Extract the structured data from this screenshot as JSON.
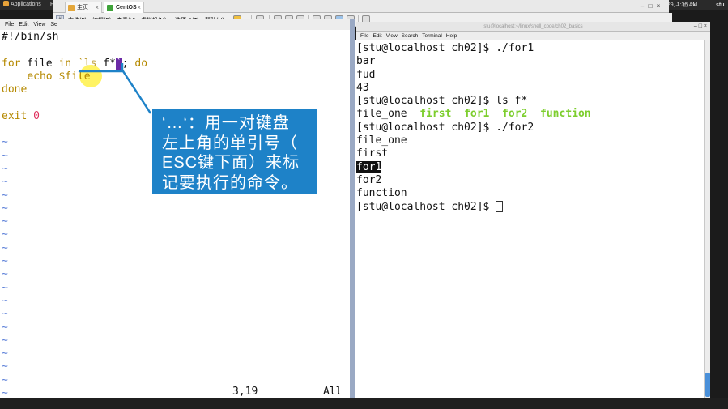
{
  "topbar": {
    "applications": "Applications",
    "places": "Pl",
    "clock": "h 29,  1:36 AM",
    "user": "stu"
  },
  "vmware": {
    "tabs": [
      {
        "label": "主页",
        "icon_color": "#e3a63a"
      },
      {
        "label": "CentOS",
        "icon_color": "#3fa33a"
      }
    ],
    "menu": [
      "文件(F)",
      "编辑(E)",
      "查看(V)",
      "虚拟机(M)",
      "选项卡(T)",
      "帮助(H)"
    ]
  },
  "vim": {
    "menu": [
      "File",
      "Edit",
      "View",
      "Se"
    ],
    "lines": {
      "shebang": "#!/bin/sh",
      "for_kw": "for",
      "file_var": " file ",
      "in_kw": "in",
      "space": " ",
      "backtick": "`",
      "ls_cmd": "ls",
      "glob": " f*",
      "cursor_char": "`",
      "semi": "; ",
      "do_kw": "do",
      "echo_indent": "    ",
      "echo_kw": "echo",
      "echo_var": " $file",
      "done_kw": "done",
      "exit_kw": "exit",
      "exit_code": "0",
      "tilde": "~"
    },
    "status_position": "3,19",
    "status_scope": "All"
  },
  "annotation": {
    "lines": [
      "‘…‘：用一对键盘",
      "左上角的单引号（",
      "ESC键下面）来标",
      "记要执行的命令。"
    ]
  },
  "terminal": {
    "title": "stu@localhost:~/linux/shell_code/ch02_basics",
    "menu": [
      "File",
      "Edit",
      "View",
      "Search",
      "Terminal",
      "Help"
    ],
    "prompt": "[stu@localhost ch02]$ ",
    "cmd1": "./for1",
    "out1": [
      "bar",
      "fud",
      "43"
    ],
    "cmd2": "ls f*",
    "ls_plain": "file_one",
    "ls_exec": [
      "first",
      "for1",
      "for2",
      "function"
    ],
    "cmd3": "./for2",
    "out3_a": "file_one",
    "out3_b": "first",
    "out3_sel": "for1",
    "out3_c": "for2",
    "out3_d": "function"
  },
  "colors": {
    "annotation_bg": "#1e82c8",
    "exec_green": "#7dce2e",
    "vim_keyword": "#b58900",
    "vim_number": "#e0335f",
    "vim_tilde": "#5a7ed8"
  }
}
